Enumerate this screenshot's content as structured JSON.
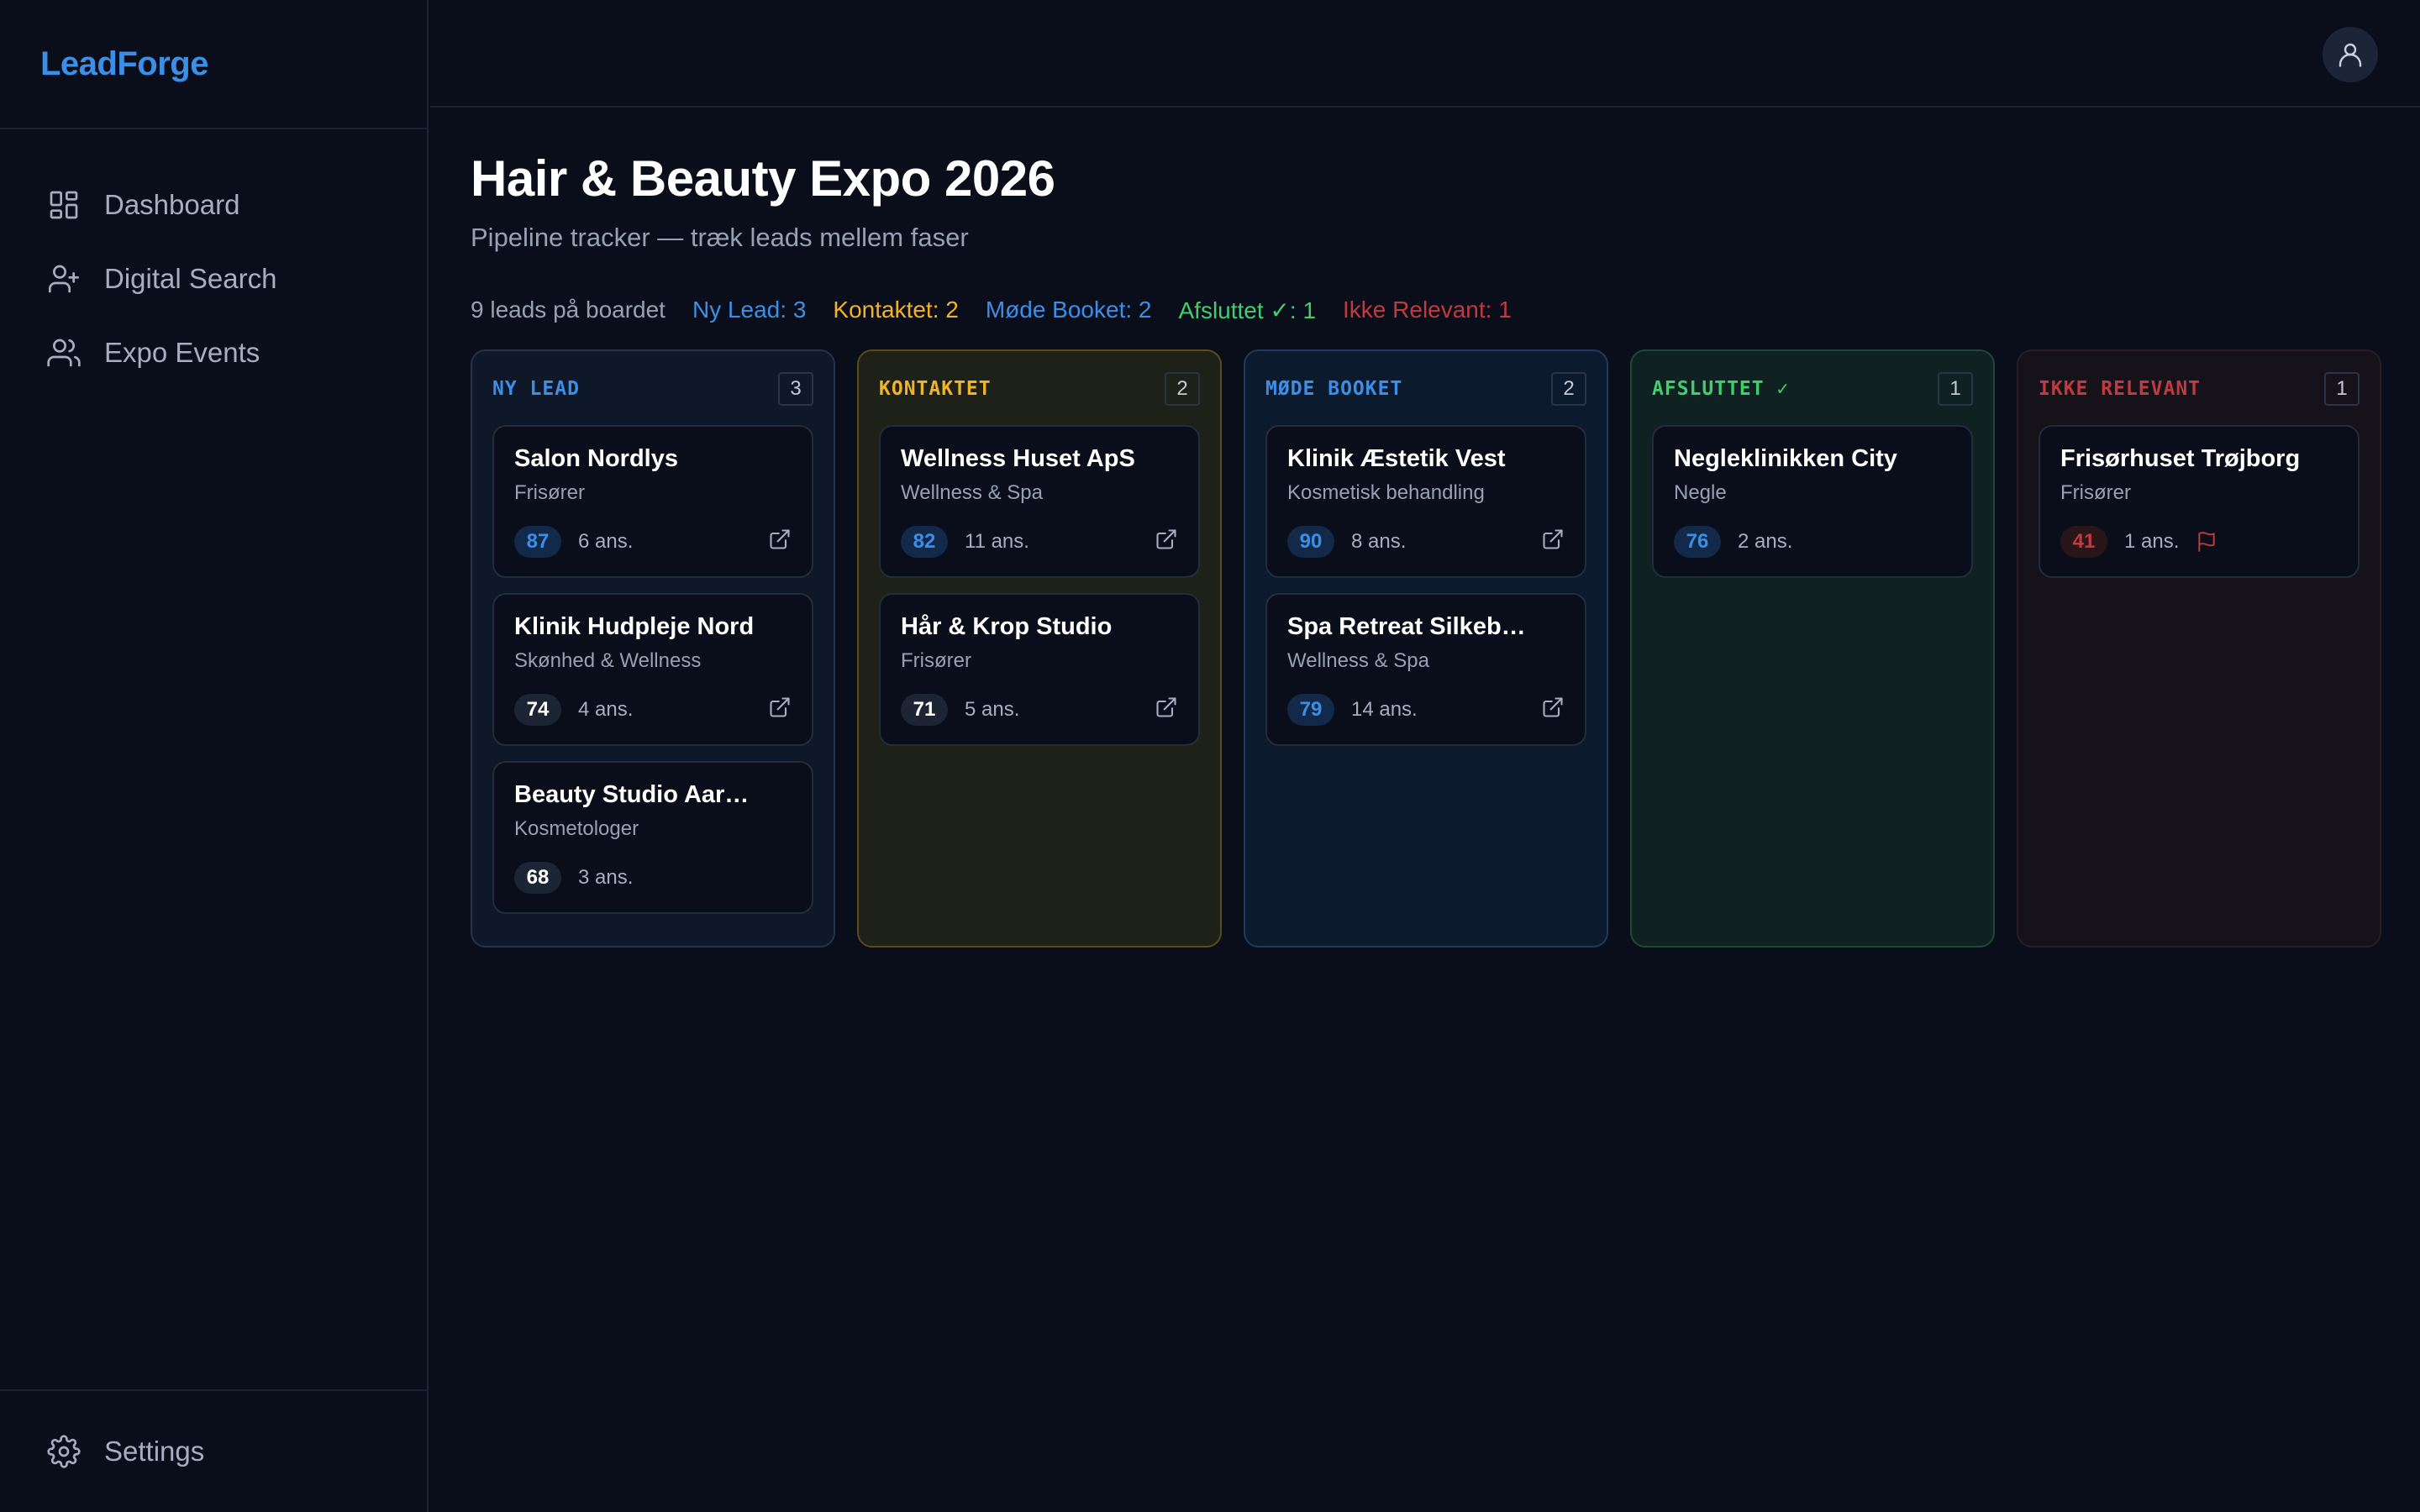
{
  "app": {
    "logo": "LeadForge"
  },
  "sidebar": {
    "items": [
      {
        "label": "Dashboard",
        "icon": "dashboard-icon"
      },
      {
        "label": "Digital Search",
        "icon": "user-plus-icon"
      },
      {
        "label": "Expo Events",
        "icon": "users-icon"
      }
    ],
    "footer": {
      "label": "Settings",
      "icon": "gear-icon"
    }
  },
  "header": {
    "avatar_icon": "user-icon"
  },
  "page": {
    "title": "Hair & Beauty Expo 2026",
    "subtitle": "Pipeline tracker — træk leads mellem faser"
  },
  "stats": {
    "total": "9 leads på boardet",
    "ny_lead": "Ny Lead: 3",
    "kontaktet": "Kontaktet: 2",
    "mode_booket": "Møde Booket: 2",
    "afsluttet": "Afsluttet ✓: 1",
    "ikke_relevant": "Ikke Relevant: 1"
  },
  "colors": {
    "blue": "#3b8fe6",
    "yellow": "#f0b429",
    "green": "#3fcf6e",
    "red": "#c2393f"
  },
  "columns": [
    {
      "title": "NY LEAD",
      "count": "3",
      "cards": [
        {
          "name": "Salon Nordlys",
          "category": "Frisører",
          "score": "87",
          "employees": "6 ans."
        },
        {
          "name": "Klinik Hudpleje Nord",
          "category": "Skønhed & Wellness",
          "score": "74",
          "employees": "4 ans."
        },
        {
          "name": "Beauty Studio Aar…",
          "category": "Kosmetologer",
          "score": "68",
          "employees": "3 ans."
        }
      ]
    },
    {
      "title": "KONTAKTET",
      "count": "2",
      "cards": [
        {
          "name": "Wellness Huset ApS",
          "category": "Wellness & Spa",
          "score": "82",
          "employees": "11 ans."
        },
        {
          "name": "Hår & Krop Studio",
          "category": "Frisører",
          "score": "71",
          "employees": "5 ans."
        }
      ]
    },
    {
      "title": "MØDE BOOKET",
      "count": "2",
      "cards": [
        {
          "name": "Klinik Æstetik Vest",
          "category": "Kosmetisk behandling",
          "score": "90",
          "employees": "8 ans."
        },
        {
          "name": "Spa Retreat Silkeb…",
          "category": "Wellness & Spa",
          "score": "79",
          "employees": "14 ans."
        }
      ]
    },
    {
      "title": "AFSLUTTET ✓",
      "count": "1",
      "cards": [
        {
          "name": "Negleklinikken City",
          "category": "Negle",
          "score": "76",
          "employees": "2 ans."
        }
      ]
    },
    {
      "title": "IKKE RELEVANT",
      "count": "1",
      "cards": [
        {
          "name": "Frisørhuset Trøjborg",
          "category": "Frisører",
          "score": "41",
          "employees": "1 ans."
        }
      ]
    }
  ]
}
